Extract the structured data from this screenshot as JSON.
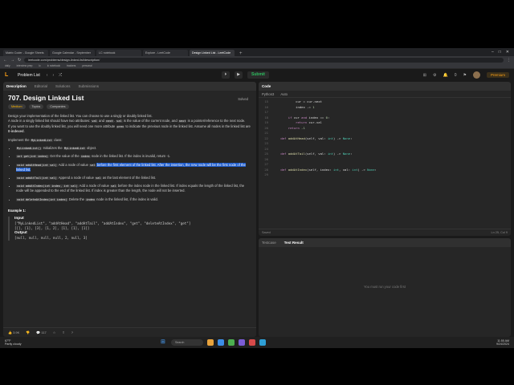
{
  "browser": {
    "tabs": [
      "Matrix Coder - Google Sheets",
      "Google Calendar - September",
      "LC notebook",
      "Explore - LeetCode",
      "Design Linked List - LeetCode"
    ],
    "url": "leetcode.com/problems/design-linked-list/description/",
    "bookmarks": [
      "daily",
      "interview prep",
      "lc",
      "lc notebook",
      "trackers",
      "personal"
    ],
    "new_tab": "+",
    "window_controls": [
      "–",
      "□",
      "✕"
    ],
    "nav": [
      "←",
      "→",
      "↻"
    ],
    "menu": "⋮"
  },
  "header": {
    "logo": "L",
    "title": "Problem List",
    "nav": [
      "‹",
      "›",
      "⤮"
    ],
    "run": "▶",
    "debug": "⏵",
    "submit": "Submit",
    "icons": [
      "⚙",
      "⊞",
      "🔔",
      "0",
      "⚑"
    ],
    "premium": "Premium"
  },
  "left_tabs": [
    "Description",
    "Editorial",
    "Solutions",
    "Submissions"
  ],
  "problem": {
    "title": "707. Design Linked List",
    "status": "Solved",
    "difficulty": "Medium",
    "tags": [
      "Topics",
      "Companies"
    ],
    "intro1": "Design your implementation of the linked list. You can choose to use a singly or doubly linked list.",
    "intro2a": "A node in a singly linked list should have two attributes: ",
    "c_val": "val",
    "intro2b": " and ",
    "c_next": "next",
    "intro2c": ". ",
    "intro2d": " is the value of the current node, and ",
    "intro2e": " is a pointer/reference to the next node.",
    "intro3a": "If you want to use the doubly linked list, you will need one more attribute ",
    "c_prev": "prev",
    "intro3b": " to indicate the previous node in the linked list. Assume all nodes in the linked list are ",
    "zero_indexed": "0-indexed",
    "intro3c": ".",
    "impl_a": "Implement the ",
    "c_class": "MyLinkedList",
    "impl_b": " class:",
    "methods": [
      {
        "sig": "MyLinkedList()",
        "desc": " Initializes the ",
        "code2": "MyLinkedList",
        "rest": " object."
      },
      {
        "sig": "int get(int index)",
        "desc": " Get the value of the ",
        "code2": "index",
        "rest": " node in the linked list. If the index is invalid, return -1."
      },
      {
        "sig": "void addAtHead(int val)",
        "desc": " Add a node of value ",
        "code2": "val",
        "rest": " before the first element of the linked list. After the insertion, the new node will be the first node of the linked list."
      },
      {
        "sig": "void addAtTail(int val)",
        "desc": " Append a node of value ",
        "code2": "val",
        "rest": " as the last element of the linked list."
      },
      {
        "sig": "void addAtIndex(int index, int val)",
        "desc": " Add a node of value ",
        "code2": "val",
        "rest": " before the index node in the linked list. If index equals the length of the linked list, the node will be appended to the end of the linked list. If index is greater than the length, the node will not be inserted."
      },
      {
        "sig": "void deleteAtIndex(int index)",
        "desc": " Delete the ",
        "code2": "index",
        "rest": " node in the linked list, if the index is valid."
      }
    ],
    "example_title": "Example 1:",
    "input_label": "Input",
    "input_line1": "[\"MyLinkedList\", \"addAtHead\", \"addAtTail\", \"addAtIndex\", \"get\", \"deleteAtIndex\", \"get\"]",
    "input_line2": "[[], [1], [3], [1, 2], [1], [1], [1]]",
    "output_label": "Output",
    "output_line": "[null, null, null, null, 2, null, 3]",
    "footer": [
      "👍 3.9K",
      "👎",
      "💬 117",
      "☆",
      "⇪",
      "?"
    ]
  },
  "code": {
    "tab": "Code",
    "language": "Python3",
    "mode": "Auto",
    "lines": [
      {
        "n": "15",
        "t": "            cur = cur.next"
      },
      {
        "n": "16",
        "t": "            index -= 1"
      },
      {
        "n": "17",
        "t": ""
      },
      {
        "n": "18",
        "t": "        if cur and index == 0:"
      },
      {
        "n": "19",
        "t": "            return cur.val"
      },
      {
        "n": "20",
        "t": "        return -1"
      },
      {
        "n": "21",
        "t": ""
      },
      {
        "n": "22",
        "t": "    def addAtHead(self, val: int) -> None:"
      },
      {
        "n": "23",
        "t": ""
      },
      {
        "n": "24",
        "t": ""
      },
      {
        "n": "25",
        "t": "    def addAtTail(self, val: int) -> None:"
      },
      {
        "n": "26",
        "t": ""
      },
      {
        "n": "27",
        "t": ""
      },
      {
        "n": "28",
        "t": "    def addAtIndex(self, index: int, val: int) -> None:"
      },
      {
        "n": "29",
        "t": ""
      }
    ],
    "saved": "Saved",
    "cursor": "Ln 25, Col 9"
  },
  "result": {
    "tabs": [
      "Testcase",
      "Test Result"
    ],
    "empty": "You must run your code first"
  },
  "taskbar": {
    "temp": "67°F",
    "weather": "Partly cloudy",
    "search": "Search",
    "time": "11:55 AM",
    "date": "9/24/2024"
  }
}
